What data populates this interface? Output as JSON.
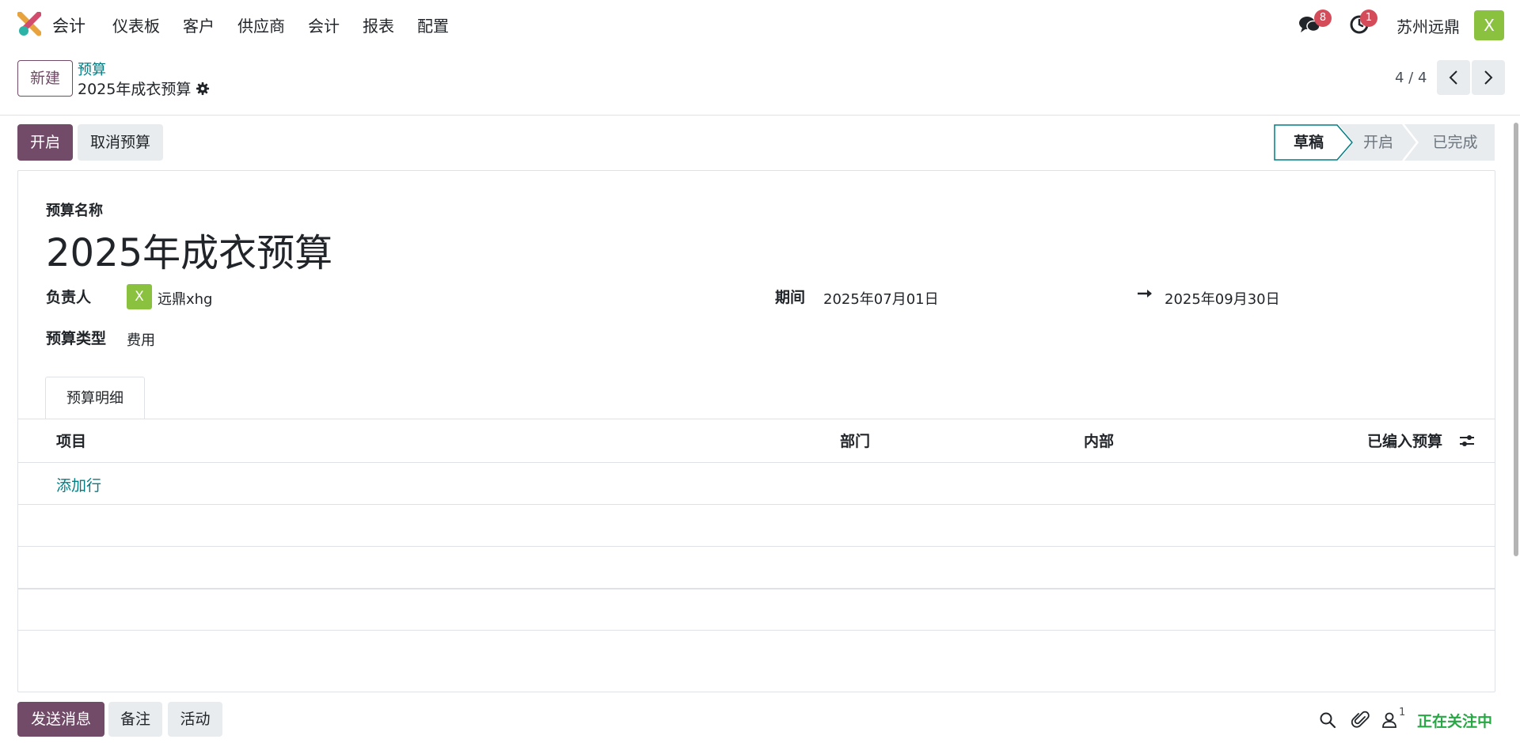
{
  "navbar": {
    "brand": "会计",
    "menu": [
      "仪表板",
      "客户",
      "供应商",
      "会计",
      "报表",
      "配置"
    ],
    "chat_count": "8",
    "activity_count": "1",
    "company": "苏州远鼎",
    "user_initial": "X",
    "icons": {
      "logo": "app-logo-icon",
      "chat": "chat-bubbles-icon",
      "activity": "clock-icon"
    }
  },
  "control_panel": {
    "new_label": "新建",
    "breadcrumb_parent": "预算",
    "breadcrumb_current": "2025年成衣预算",
    "pager": "4 / 4"
  },
  "actions": {
    "open_label": "开启",
    "cancel_label": "取消预算"
  },
  "statusbar": {
    "steps": [
      "草稿",
      "开启",
      "已完成"
    ],
    "active": "草稿"
  },
  "form": {
    "name_label": "预算名称",
    "name_value": "2025年成衣预算",
    "owner_label": "负责人",
    "owner_initial": "X",
    "owner_value": "远鼎xhg",
    "type_label": "预算类型",
    "type_value": "费用",
    "period_label": "期间",
    "period_start": "2025年07月01日",
    "period_end": "2025年09月30日"
  },
  "tabs": [
    "预算明细"
  ],
  "lines_table": {
    "columns": [
      "项目",
      "部门",
      "内部",
      "已编入预算"
    ],
    "add_line_label": "添加行",
    "rows": []
  },
  "chatter": {
    "send_label": "发送消息",
    "note_label": "备注",
    "activity_label": "活动",
    "follower_count": "1",
    "follow_status": "正在关注中"
  },
  "colors": {
    "primary": "#714b67",
    "link": "#017e84",
    "badge": "#d44c59",
    "avatar": "#8ac23f",
    "following": "#28a745"
  }
}
